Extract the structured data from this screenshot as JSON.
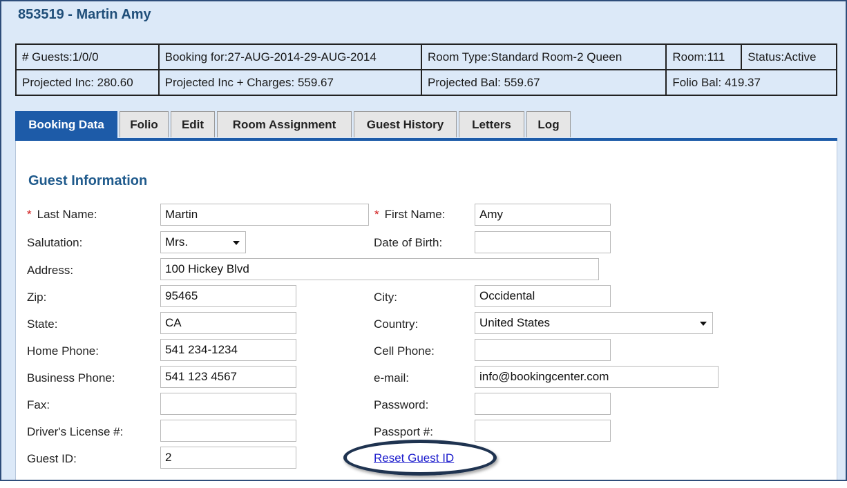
{
  "header": {
    "title": "853519 - Martin Amy"
  },
  "summary": {
    "guests": "# Guests:1/0/0",
    "booking_for": "Booking for:27-AUG-2014-29-AUG-2014",
    "room_type": "Room Type:Standard Room-2 Queen",
    "room": "Room:111",
    "status": "Status:Active",
    "projected_inc": "Projected Inc: 280.60",
    "projected_inc_charges": "Projected Inc + Charges: 559.67",
    "projected_bal": "Projected Bal: 559.67",
    "folio_bal": "Folio Bal: 419.37"
  },
  "tabs": [
    {
      "label": "Booking Data",
      "active": true
    },
    {
      "label": "Folio"
    },
    {
      "label": "Edit"
    },
    {
      "label": "Room Assignment"
    },
    {
      "label": "Guest History"
    },
    {
      "label": "Letters"
    },
    {
      "label": "Log"
    }
  ],
  "form": {
    "section_title": "Guest Information",
    "required_marker": "*",
    "last_name": {
      "label": "Last Name:",
      "value": "Martin"
    },
    "first_name": {
      "label": "First Name:",
      "value": "Amy"
    },
    "salutation": {
      "label": "Salutation:",
      "value": "Mrs."
    },
    "date_of_birth": {
      "label": "Date of Birth:",
      "value": ""
    },
    "address": {
      "label": "Address:",
      "value": "100 Hickey Blvd"
    },
    "zip": {
      "label": "Zip:",
      "value": "95465"
    },
    "city": {
      "label": "City:",
      "value": "Occidental"
    },
    "state": {
      "label": "State:",
      "value": "CA"
    },
    "country": {
      "label": "Country:",
      "value": "United States"
    },
    "home_phone": {
      "label": "Home Phone:",
      "value": "541 234-1234"
    },
    "cell_phone": {
      "label": "Cell Phone:",
      "value": ""
    },
    "business_phone": {
      "label": "Business Phone:",
      "value": "541 123 4567"
    },
    "email": {
      "label": "e-mail:",
      "value": "info@bookingcenter.com"
    },
    "fax": {
      "label": "Fax:",
      "value": ""
    },
    "password": {
      "label": "Password:",
      "value": ""
    },
    "drivers_license": {
      "label": "Driver's License #:",
      "value": ""
    },
    "passport": {
      "label": "Passport #:",
      "value": ""
    },
    "guest_id": {
      "label": "Guest ID:",
      "value": "2"
    },
    "reset_guest_id_link": "Reset Guest ID"
  },
  "colors": {
    "frame_bg": "#dce9f8",
    "tab_active": "#1d5ba8",
    "title_blue": "#1f4e79",
    "highlight_oval": "#1f3350",
    "required_red": "#d01818"
  }
}
